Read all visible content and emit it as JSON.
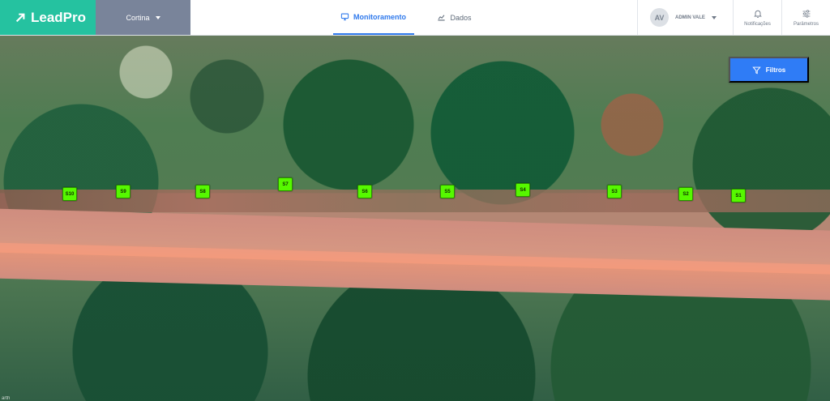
{
  "header": {
    "brand": "LeadPro",
    "project": "Cortina",
    "tabs": [
      {
        "label": "Monitoramento",
        "icon": "monitor-icon",
        "active": true
      },
      {
        "label": "Dados",
        "icon": "chart-icon",
        "active": false
      }
    ],
    "user": {
      "initials": "AV",
      "name": "ADMIN VALE"
    },
    "actions": [
      {
        "label": "Notificações",
        "icon": "bell-icon"
      },
      {
        "label": "Parâmetros",
        "icon": "sliders-icon"
      }
    ]
  },
  "map": {
    "filter_label": "Filtros",
    "attribution": "arth",
    "sensors": [
      {
        "label": "S10"
      },
      {
        "label": "S9"
      },
      {
        "label": "S8"
      },
      {
        "label": "S7"
      },
      {
        "label": "S6"
      },
      {
        "label": "S5"
      },
      {
        "label": "S4"
      },
      {
        "label": "S3"
      },
      {
        "label": "S2"
      },
      {
        "label": "S1"
      }
    ]
  },
  "colors": {
    "brand": "#25c2a0",
    "project_bar": "#79849a",
    "active_tab": "#2f79ec",
    "filter_button": "#2f7cf6",
    "sensor": "#56f800"
  }
}
